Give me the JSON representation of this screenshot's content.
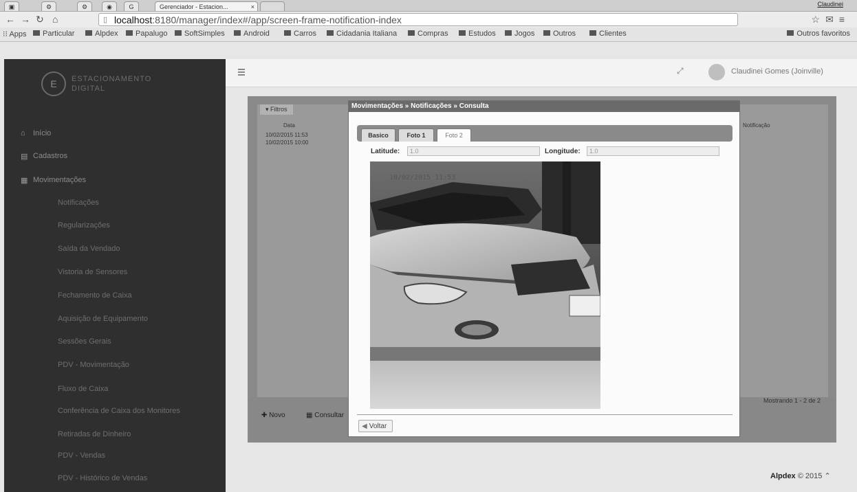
{
  "browser": {
    "tab_title": "Gerenciador - Estacion...",
    "tab_close": "×",
    "user": "Claudinei",
    "url_host": "localhost",
    "url_rest": ":8180/manager/index#/app/screen-frame-notification-index",
    "bookmarks": [
      "Apps",
      "Particular",
      "Alpdex",
      "Papalugo",
      "SoftSimples",
      "Android",
      "Carros",
      "Cidadania Italiana",
      "Compras",
      "Estudos",
      "Jogos",
      "Outros",
      "Clientes"
    ],
    "bookmarks_right": "Outros favoritos"
  },
  "app": {
    "logo_line1": "ESTACIONAMENTO",
    "logo_line2": "DIGITAL",
    "user_name": "Claudinei Gomes (Joinville)",
    "menu": {
      "inicio": "Início",
      "cadastros": "Cadastros",
      "movimentacoes": "Movimentações",
      "submenu": [
        "Notificações",
        "Regularizações",
        "Saída da Vendado",
        "Vistoria de Sensores",
        "Fechamento de Caixa",
        "Aquisição de Equipamento",
        "Sessões Gerais",
        "PDV - Movimentação",
        "Fluxo de Caixa",
        "Conferência de Caixa dos Monitores",
        "Retiradas de Dinheiro",
        "PDV - Vendas",
        "PDV - Histórico de Vendas"
      ]
    },
    "background": {
      "filter_label": "Filtros",
      "col_date": "Data",
      "rows": [
        "10/02/2015 11:53",
        "10/02/2015 10:00"
      ],
      "right_col": "Notificação",
      "novo": "Novo",
      "consultar": "Consultar",
      "pagination": "Mostrando 1 - 2 de 2"
    },
    "footer_brand": "Alpdex",
    "footer_rest": "© 2015"
  },
  "modal": {
    "title": "Movimentações » Notificações » Consulta",
    "tabs": [
      "Basico",
      "Foto 1",
      "Foto 2"
    ],
    "latitude_label": "Latitude:",
    "latitude_value": "1.0",
    "longitude_label": "Longitude:",
    "longitude_value": "1.0",
    "photo_timestamp": "10/02/2015 11:53",
    "voltar": "Voltar"
  }
}
